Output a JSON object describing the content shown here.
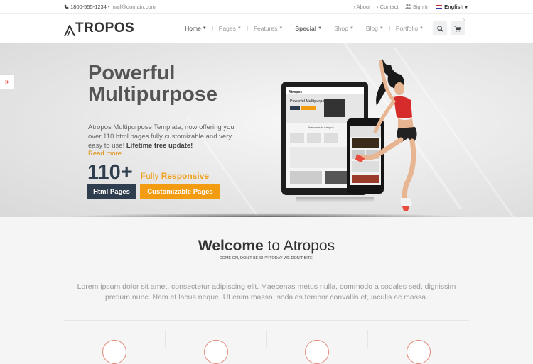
{
  "topbar": {
    "phone": "1800-555-1234",
    "bullet": "•",
    "email": "mail@domain.com",
    "about": "› About",
    "contact": "› Contact",
    "signin": "Sign In",
    "language": "English ▾"
  },
  "header": {
    "logo": "TROPOS",
    "nav": [
      {
        "label": "Home"
      },
      {
        "label": "Pages"
      },
      {
        "label": "Features"
      },
      {
        "label": "Special"
      },
      {
        "label": "Shop"
      },
      {
        "label": "Blog"
      },
      {
        "label": "Portfolio"
      }
    ],
    "cart_count": "2"
  },
  "hero": {
    "title_line1": "Powerful",
    "title_line2": "Multipurpose",
    "desc_part1": "Atropos Multipurpose Template, now offering you over 110 html pages fully customizable and very easy to use!",
    "desc_bold": "Lifetime free update!",
    "read_more": "Read more...",
    "count": "110+",
    "fully": "Fully",
    "responsive": "Responsive",
    "tag_html": "Html Pages",
    "tag_custom": "Customizable Pages"
  },
  "mock": {
    "logo": "Atropos",
    "title": "Powerful Multipurpose",
    "welcome": "Welcome to Atropos"
  },
  "welcome": {
    "bold": "Welcome",
    "rest": " to Atropos",
    "sub": "COME ON, DON'T BE SHY! TODAY WE DON'T BITE!"
  },
  "lorem": "Lorem ipsum dolor sit amet, consectetur adipiscing elit. Maecenas metus nulla, commodo a sodales sed, dignissim pretium nunc. Nam et lacus neque. Ut enim massa, sodales tempor convallis et, iaculis ac massa.",
  "colors": {
    "accent_orange": "#f39c12",
    "dark_navy": "#2f3e4e",
    "red": "#e74c3c"
  }
}
